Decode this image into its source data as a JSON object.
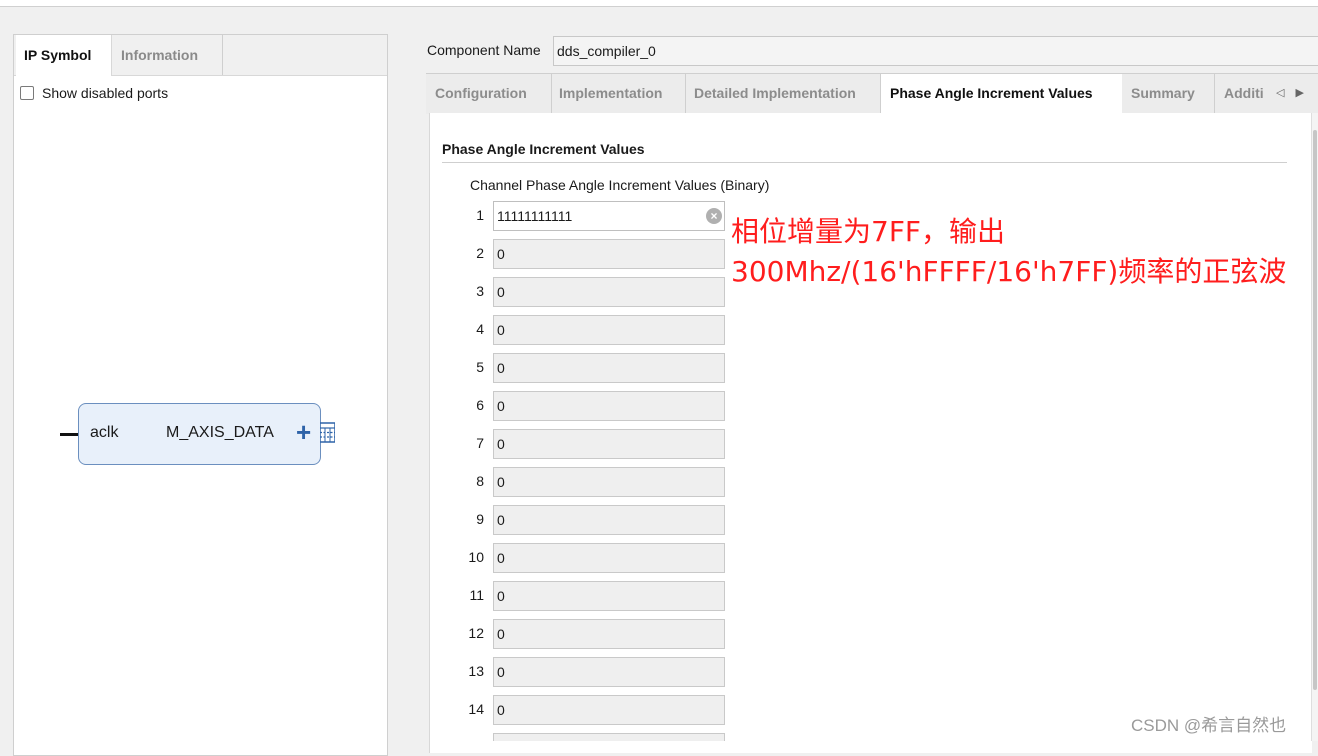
{
  "left_panel": {
    "tabs": [
      {
        "label": "IP Symbol"
      },
      {
        "label": "Information"
      }
    ],
    "show_disabled_ports_label": "Show disabled ports",
    "ip_block": {
      "port_left": "aclk",
      "port_right": "M_AXIS_DATA",
      "expand_symbol": "+"
    }
  },
  "component": {
    "label": "Component Name",
    "value": "dds_compiler_0"
  },
  "tabs": [
    {
      "label": "Configuration"
    },
    {
      "label": "Implementation"
    },
    {
      "label": "Detailed Implementation"
    },
    {
      "label": "Phase Angle Increment Values",
      "active": true
    },
    {
      "label": "Summary"
    },
    {
      "label": "Additi"
    }
  ],
  "tab_scroll": {
    "left": "◁",
    "right": "▶"
  },
  "section": {
    "title": "Phase Angle Increment Values",
    "channel_label": "Channel Phase Angle Increment Values (Binary)",
    "rows": [
      {
        "num": "1",
        "value": "11111111111"
      },
      {
        "num": "2",
        "value": "0"
      },
      {
        "num": "3",
        "value": "0"
      },
      {
        "num": "4",
        "value": "0"
      },
      {
        "num": "5",
        "value": "0"
      },
      {
        "num": "6",
        "value": "0"
      },
      {
        "num": "7",
        "value": "0"
      },
      {
        "num": "8",
        "value": "0"
      },
      {
        "num": "9",
        "value": "0"
      },
      {
        "num": "10",
        "value": "0"
      },
      {
        "num": "11",
        "value": "0"
      },
      {
        "num": "12",
        "value": "0"
      },
      {
        "num": "13",
        "value": "0"
      },
      {
        "num": "14",
        "value": "0"
      }
    ]
  },
  "annotation": {
    "line1": "相位增量为7FF，输出",
    "line2": "300Mhz/(16'hFFFF/16'h7FF)频率的正弦波"
  },
  "watermark": "CSDN @希言自然也",
  "colors": {
    "annotation": "#ff1d1d",
    "ip_block_fill": "#e8f0fa",
    "ip_block_border": "#6b8fbf",
    "plus": "#2e63a8"
  }
}
